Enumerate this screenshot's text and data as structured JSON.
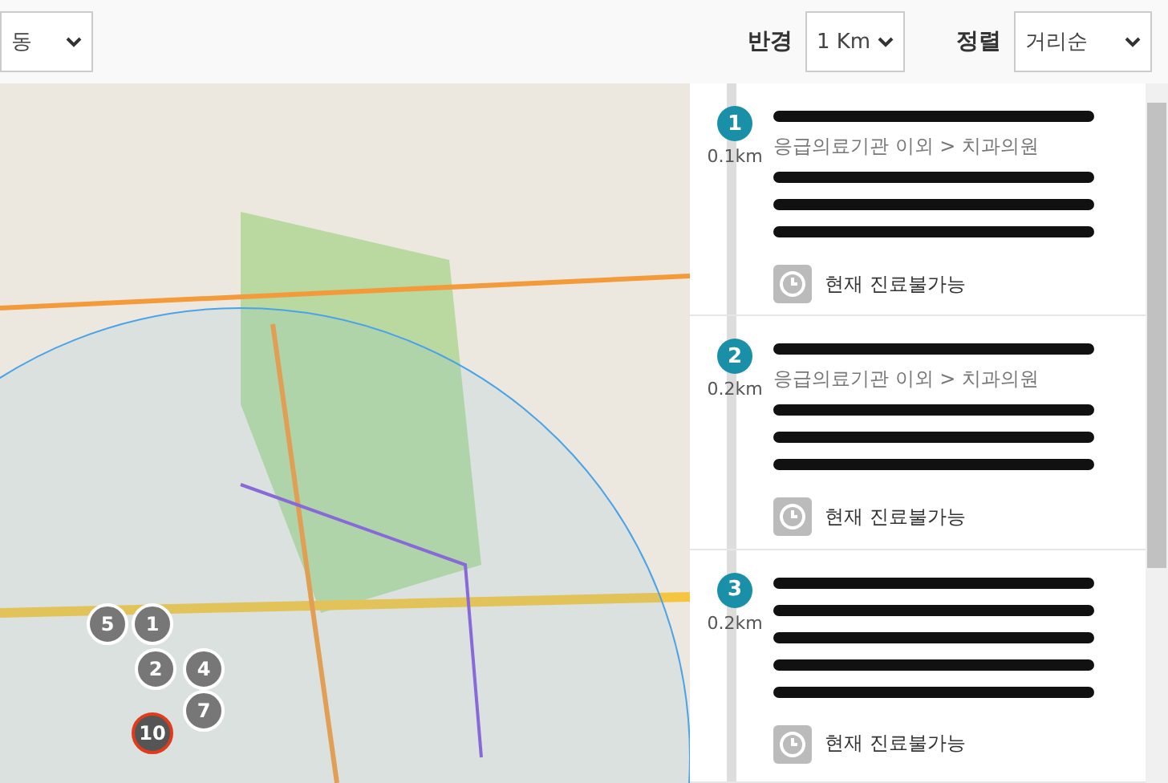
{
  "filters": {
    "area": {
      "value": "동"
    },
    "radius": {
      "label": "반경",
      "value": "1 Km"
    },
    "sort": {
      "label": "정렬",
      "value": "거리순"
    }
  },
  "map": {
    "markers": [
      {
        "label": "5",
        "selected": false
      },
      {
        "label": "1",
        "selected": false
      },
      {
        "label": "2",
        "selected": false
      },
      {
        "label": "4",
        "selected": false
      },
      {
        "label": "7",
        "selected": false
      },
      {
        "label": "10",
        "selected": true
      }
    ]
  },
  "results": [
    {
      "number": "1",
      "distance": "0.1km",
      "rows": [
        {
          "kind": "redacted"
        },
        {
          "kind": "text",
          "text": "응급의료기관 이외 > 치과의원"
        },
        {
          "kind": "redacted"
        },
        {
          "kind": "redacted"
        },
        {
          "kind": "redacted"
        }
      ],
      "status": "현재 진료불가능"
    },
    {
      "number": "2",
      "distance": "0.2km",
      "rows": [
        {
          "kind": "redacted"
        },
        {
          "kind": "text",
          "text": "응급의료기관 이외 > 치과의원"
        },
        {
          "kind": "redacted"
        },
        {
          "kind": "redacted"
        },
        {
          "kind": "redacted"
        }
      ],
      "status": "현재 진료불가능"
    },
    {
      "number": "3",
      "distance": "0.2km",
      "rows": [
        {
          "kind": "redacted"
        },
        {
          "kind": "redacted"
        },
        {
          "kind": "redacted"
        },
        {
          "kind": "redacted"
        },
        {
          "kind": "redacted"
        }
      ],
      "status": "현재 진료불가능"
    }
  ]
}
